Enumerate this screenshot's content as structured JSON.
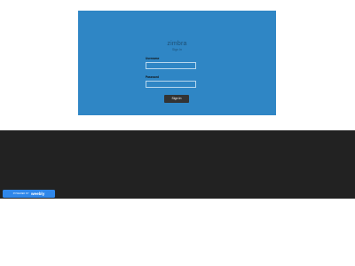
{
  "login": {
    "brand": "zimbra",
    "subtitle": "Sign In",
    "username_label": "Username",
    "username_value": "",
    "password_label": "Password",
    "password_value": "",
    "signin_label": "Sign In"
  },
  "footer_badge": {
    "powered_by": "POWERED BY",
    "brand": "weebly"
  },
  "colors": {
    "panel_bg": "#2f86c5",
    "dark_band": "#222222",
    "badge_bg": "#2f87ea",
    "button_bg": "#333333"
  }
}
